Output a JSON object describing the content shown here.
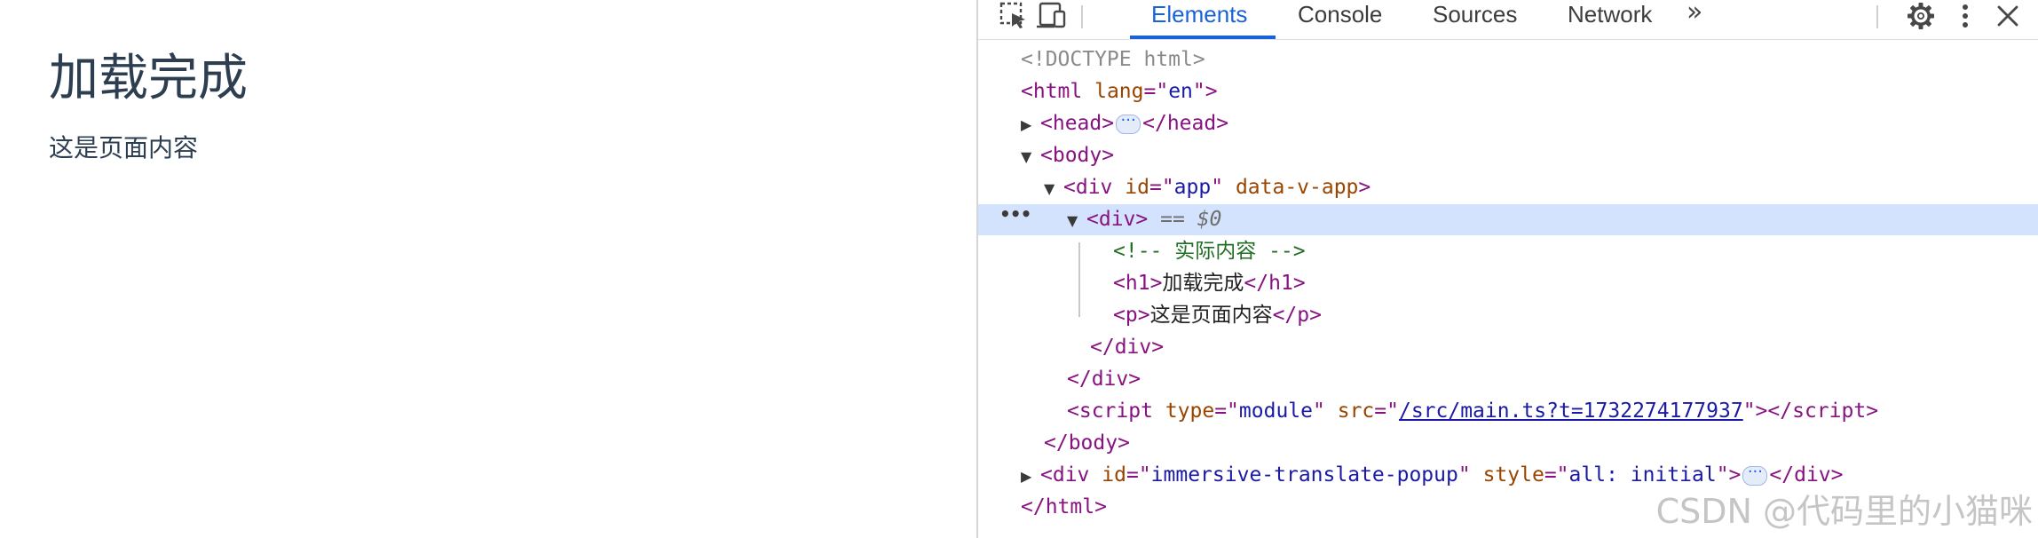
{
  "page": {
    "title": "加载完成",
    "paragraph": "这是页面内容"
  },
  "devtools": {
    "tabs": [
      "Elements",
      "Console",
      "Sources",
      "Network"
    ],
    "active_tab": "Elements",
    "more_tabs_label": "»",
    "icons": {
      "inspect": "element-picker-icon",
      "device": "device-toolbar-icon",
      "settings": "gear-icon",
      "menu": "vertical-dots-icon",
      "close": "close-icon"
    },
    "dom": {
      "doctype": "<!DOCTYPE html>",
      "html_tag": "html",
      "html_attr_name": "lang",
      "html_attr_val": "en",
      "head_tag": "head",
      "body_tag": "body",
      "app_div_tag": "div",
      "app_id_name": "id",
      "app_id_val": "app",
      "app_extra_attr": "data-v-app",
      "selected_tag": "div",
      "selected_ref_eq": "==",
      "selected_ref": "$0",
      "comment": "<!-- 实际内容 -->",
      "h1_tag": "h1",
      "h1_text": "加载完成",
      "p_tag": "p",
      "p_text": "这是页面内容",
      "script_tag": "script",
      "script_type_name": "type",
      "script_type_val": "module",
      "script_src_name": "src",
      "script_src_val": "/src/main.ts?t=1732274177937",
      "popup_tag": "div",
      "popup_id_name": "id",
      "popup_id_val": "immersive-translate-popup",
      "popup_style_name": "style",
      "popup_style_val": "all: initial"
    },
    "colors": {
      "accent": "#1a62d8",
      "selected_row": "#d3e3fd",
      "tag": "#881280",
      "attr_name": "#994500",
      "attr_value": "#1a1aa6",
      "comment": "#236e25"
    }
  },
  "watermark": "CSDN @代码里的小猫咪"
}
